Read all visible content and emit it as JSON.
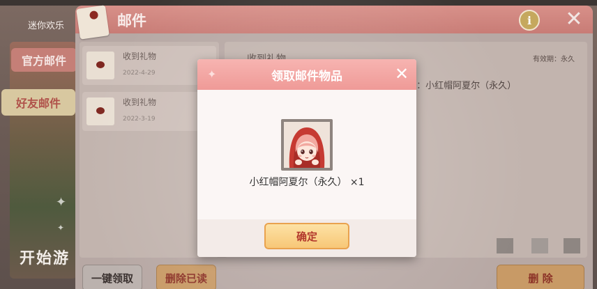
{
  "background": {
    "top_text": "",
    "side_label": "迷你欢乐",
    "scene_text": "开始游"
  },
  "mail_window": {
    "title": "邮件",
    "info_label": "i",
    "close_label": "✕",
    "tabs": [
      {
        "label": "官方邮件",
        "selected": false
      },
      {
        "label": "好友邮件",
        "selected": true
      }
    ],
    "mail_items": [
      {
        "subject": "收到礼物",
        "date": "2022-4-29"
      },
      {
        "subject": "收到礼物",
        "date": "2022-3-19"
      }
    ],
    "detail": {
      "subject": "收到礼物",
      "validity": "有效期：永久",
      "item_text": "]：小红帽阿夏尔（永久）"
    },
    "buttons": {
      "collect_all": "一键领取",
      "delete_read": "删除已读",
      "delete": "删 除"
    }
  },
  "modal": {
    "title": "领取邮件物品",
    "close_label": "✕",
    "item_name": "小红帽阿夏尔（永久）",
    "item_quantity": "×1",
    "confirm_label": "确定"
  },
  "colors": {
    "header_pink": "#ef9a97",
    "confirm_gold": "#f7c777",
    "confirm_text": "#b2372c"
  }
}
